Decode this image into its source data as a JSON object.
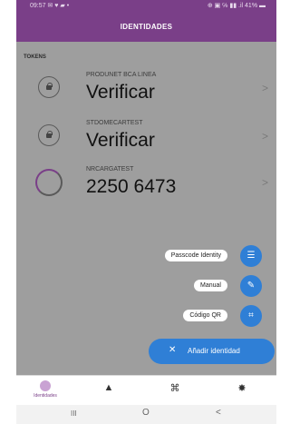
{
  "status_bar": {
    "left": "09:57 ✉ ♥ ▰ •",
    "right": "⊕ ▣ ℅ ▮▮ .il 41% ▬"
  },
  "app_bar": {
    "title": "IDENTIDADES"
  },
  "section": {
    "label": "TOKENS"
  },
  "tokens": [
    {
      "name": "PRODUNET BCA LINEA",
      "code": "Verificar",
      "icon": "lock-icon"
    },
    {
      "name": "STDOMECARTEST",
      "code": "Verificar",
      "icon": "lock-icon"
    },
    {
      "name": "NRCARGATEST",
      "code": "2250 6473",
      "icon": "progress-ring-icon"
    }
  ],
  "chevron": ">",
  "fab_menu": [
    {
      "label": "Passcode Identity",
      "icon": "chat-icon",
      "glyph": "☰"
    },
    {
      "label": "Manual",
      "icon": "pencil-icon",
      "glyph": "✎"
    },
    {
      "label": "Código QR",
      "icon": "qr-scan-icon",
      "glyph": "⌗"
    }
  ],
  "add_button": {
    "label": "Añadir identidad",
    "glyph": "✕"
  },
  "bottom_nav": {
    "identities_label": "Identidades",
    "bell_glyph": "▲",
    "scan_glyph": "⌘",
    "settings_glyph": "✸"
  },
  "system_nav": {
    "recent": "III",
    "home": "O",
    "back": "<"
  },
  "colors": {
    "primary": "#7a3f88",
    "accent": "#2f7fd6",
    "overlay": "#9e9e9e"
  }
}
